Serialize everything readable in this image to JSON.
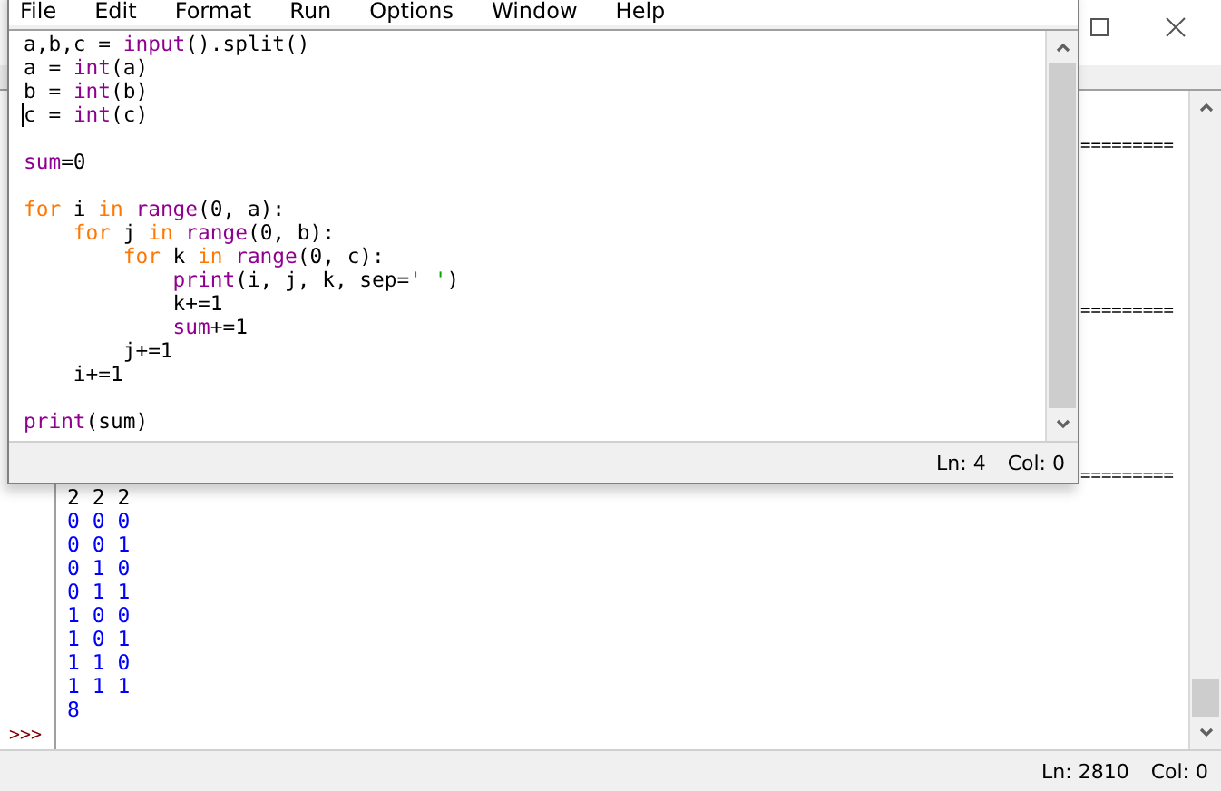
{
  "shell": {
    "separators": [
      "=========",
      "=========",
      "========="
    ],
    "lines": [
      {
        "text": "2 2 2",
        "kind": "input"
      },
      {
        "text": "0 0 0",
        "kind": "output"
      },
      {
        "text": "0 0 1",
        "kind": "output"
      },
      {
        "text": "0 1 0",
        "kind": "output"
      },
      {
        "text": "0 1 1",
        "kind": "output"
      },
      {
        "text": "1 0 0",
        "kind": "output"
      },
      {
        "text": "1 0 1",
        "kind": "output"
      },
      {
        "text": "1 1 0",
        "kind": "output"
      },
      {
        "text": "1 1 1",
        "kind": "output"
      },
      {
        "text": "8",
        "kind": "output"
      }
    ],
    "prompt": ">>>",
    "status_bar": {
      "line": "Ln: 2810",
      "column": "Col: 0"
    }
  },
  "editor": {
    "menu": [
      "File",
      "Edit",
      "Format",
      "Run",
      "Options",
      "Window",
      "Help"
    ],
    "code_blocks": [
      {
        "lines": [
          {
            "caret": false,
            "tokens": [
              {
                "text": "a,b,c = ",
                "kind": "plain"
              },
              {
                "text": "input",
                "kind": "builtin"
              },
              {
                "text": "().split()",
                "kind": "plain"
              }
            ]
          },
          {
            "caret": false,
            "tokens": [
              {
                "text": "a = ",
                "kind": "plain"
              },
              {
                "text": "int",
                "kind": "builtin"
              },
              {
                "text": "(a)",
                "kind": "plain"
              }
            ]
          },
          {
            "caret": false,
            "tokens": [
              {
                "text": "b = ",
                "kind": "plain"
              },
              {
                "text": "int",
                "kind": "builtin"
              },
              {
                "text": "(b)",
                "kind": "plain"
              }
            ]
          },
          {
            "caret": true,
            "tokens": [
              {
                "text": "c = ",
                "kind": "plain"
              },
              {
                "text": "int",
                "kind": "builtin"
              },
              {
                "text": "(c)",
                "kind": "plain"
              }
            ]
          }
        ]
      },
      {
        "lines": [
          {
            "caret": false,
            "tokens": [
              {
                "text": "sum",
                "kind": "builtin"
              },
              {
                "text": "=0",
                "kind": "plain"
              }
            ]
          }
        ]
      },
      {
        "lines": [
          {
            "caret": false,
            "tokens": [
              {
                "text": "for",
                "kind": "keyword"
              },
              {
                "text": " i ",
                "kind": "plain"
              },
              {
                "text": "in ",
                "kind": "keyword"
              },
              {
                "text": "range",
                "kind": "builtin"
              },
              {
                "text": "(0, a):",
                "kind": "plain"
              }
            ]
          },
          {
            "caret": false,
            "tokens": [
              {
                "text": "    for",
                "kind": "keyword"
              },
              {
                "text": " j ",
                "kind": "plain"
              },
              {
                "text": "in ",
                "kind": "keyword"
              },
              {
                "text": "range",
                "kind": "builtin"
              },
              {
                "text": "(0, b):",
                "kind": "plain"
              }
            ]
          },
          {
            "caret": false,
            "tokens": [
              {
                "text": "        for",
                "kind": "keyword"
              },
              {
                "text": " k ",
                "kind": "plain"
              },
              {
                "text": "in ",
                "kind": "keyword"
              },
              {
                "text": "range",
                "kind": "builtin"
              },
              {
                "text": "(0, c):",
                "kind": "plain"
              }
            ]
          },
          {
            "caret": false,
            "tokens": [
              {
                "text": "            print",
                "kind": "builtin"
              },
              {
                "text": "(i, j, k, sep=",
                "kind": "plain"
              },
              {
                "text": "' '",
                "kind": "string"
              },
              {
                "text": ")",
                "kind": "plain"
              }
            ]
          },
          {
            "caret": false,
            "tokens": [
              {
                "text": "            k+=1",
                "kind": "plain"
              }
            ]
          },
          {
            "caret": false,
            "tokens": [
              {
                "text": "            sum",
                "kind": "builtin"
              },
              {
                "text": "+=1",
                "kind": "plain"
              }
            ]
          },
          {
            "caret": false,
            "tokens": [
              {
                "text": "        j+=1",
                "kind": "plain"
              }
            ]
          },
          {
            "caret": false,
            "tokens": [
              {
                "text": "    i+=1",
                "kind": "plain"
              }
            ]
          }
        ]
      },
      {
        "lines": [
          {
            "caret": false,
            "tokens": [
              {
                "text": "print",
                "kind": "builtin"
              },
              {
                "text": "(sum)",
                "kind": "plain"
              }
            ]
          }
        ]
      }
    ],
    "status_bar": {
      "line": "Ln: 4",
      "column": "Col: 0"
    }
  }
}
